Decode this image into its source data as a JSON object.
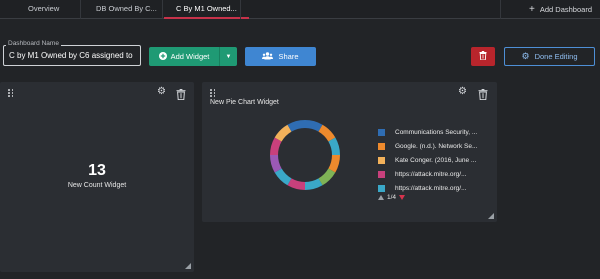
{
  "tabs": [
    {
      "label": "Overview"
    },
    {
      "label": "DB Owned By C..."
    },
    {
      "label": "C By M1 Owned..."
    }
  ],
  "add_dashboard_label": "Add Dashboard",
  "dashboard_name": {
    "label": "Dashboard Name",
    "value": "C by M1 Owned by C6 assigned to"
  },
  "toolbar": {
    "add_widget_label": "Add Widget",
    "share_label": "Share",
    "done_editing_label": "Done Editing"
  },
  "count_widget": {
    "value": "13",
    "title": "New Count Widget"
  },
  "pie_widget": {
    "title": "New Pie Chart Widget",
    "legend": [
      {
        "label": "Communications Security, ...",
        "color": "#2f6db3"
      },
      {
        "label": "Google. (n.d.). Network Se...",
        "color": "#ee8a2d"
      },
      {
        "label": "Kate Conger. (2016, June ...",
        "color": "#f2b15a"
      },
      {
        "label": "https://attack.mitre.org/...",
        "color": "#c8407c"
      },
      {
        "label": "https://attack.mitre.org/...",
        "color": "#3aa8c8"
      }
    ],
    "pager": "1/4"
  },
  "colors": {
    "accent": "#c7324a",
    "add_widget": "#1f9a74",
    "share": "#3f86d2",
    "delete": "#b8252c",
    "done_editing": "#4e8fd6"
  },
  "chart_data": {
    "type": "pie",
    "variant": "donut",
    "categories": [
      "Communications Security, ...",
      "Google. (n.d.). Network Se...",
      "Kate Conger. (2016, June ...",
      "https://attack.mitre.org/...",
      "https://attack.mitre.org/..."
    ],
    "segments": [
      {
        "color": "#2f6db3",
        "value": 1
      },
      {
        "color": "#ee8a2d",
        "value": 1
      },
      {
        "color": "#3aa8c8",
        "value": 1
      },
      {
        "color": "#ee8a2d",
        "value": 1
      },
      {
        "color": "#7fb356",
        "value": 1
      },
      {
        "color": "#3aa8c8",
        "value": 1
      },
      {
        "color": "#c8407c",
        "value": 1
      },
      {
        "color": "#3aa8c8",
        "value": 1
      },
      {
        "color": "#9b59b6",
        "value": 1
      },
      {
        "color": "#c8407c",
        "value": 1
      },
      {
        "color": "#f2b15a",
        "value": 1
      },
      {
        "color": "#2f6db3",
        "value": 1
      }
    ]
  }
}
